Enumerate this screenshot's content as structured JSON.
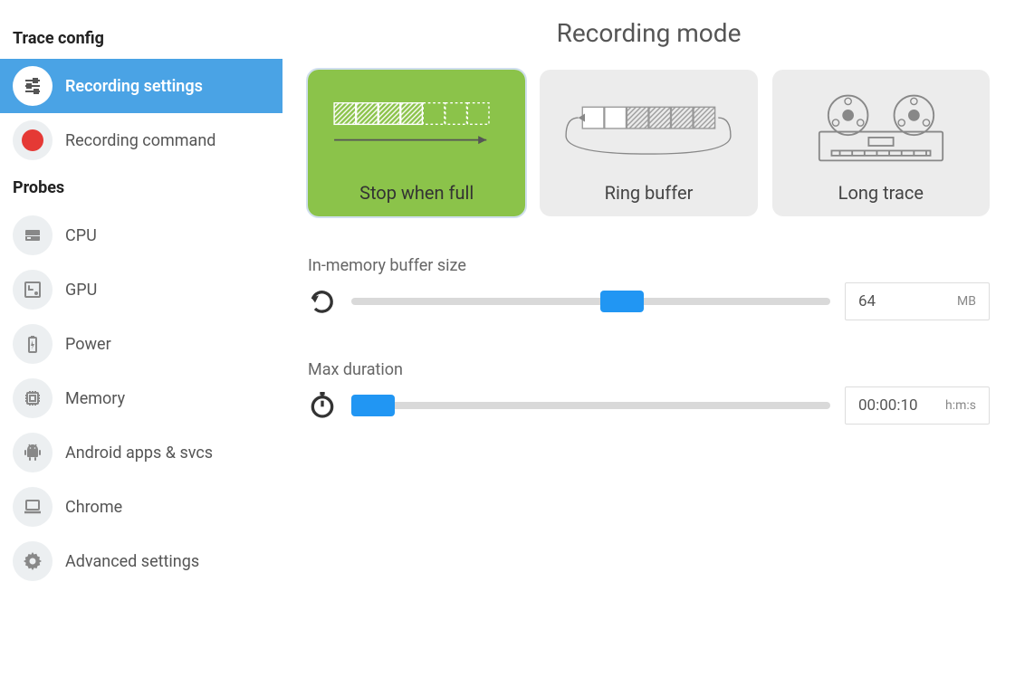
{
  "sidebar": {
    "section_trace": "Trace config",
    "section_probes": "Probes",
    "items": [
      {
        "label": "Recording settings",
        "active": true
      },
      {
        "label": "Recording command",
        "active": false
      }
    ],
    "probes": [
      {
        "label": "CPU"
      },
      {
        "label": "GPU"
      },
      {
        "label": "Power"
      },
      {
        "label": "Memory"
      },
      {
        "label": "Android apps & svcs"
      },
      {
        "label": "Chrome"
      },
      {
        "label": "Advanced settings"
      }
    ]
  },
  "main": {
    "title": "Recording mode",
    "modes": [
      {
        "label": "Stop when full",
        "active": true
      },
      {
        "label": "Ring buffer",
        "active": false
      },
      {
        "label": "Long trace",
        "active": false
      }
    ],
    "buffer_size": {
      "label": "In-memory buffer size",
      "value": "64",
      "unit": "MB",
      "slider_position_pct": 52
    },
    "max_duration": {
      "label": "Max duration",
      "value": "00:00:10",
      "unit": "h:m:s",
      "slider_position_pct": 0
    }
  }
}
